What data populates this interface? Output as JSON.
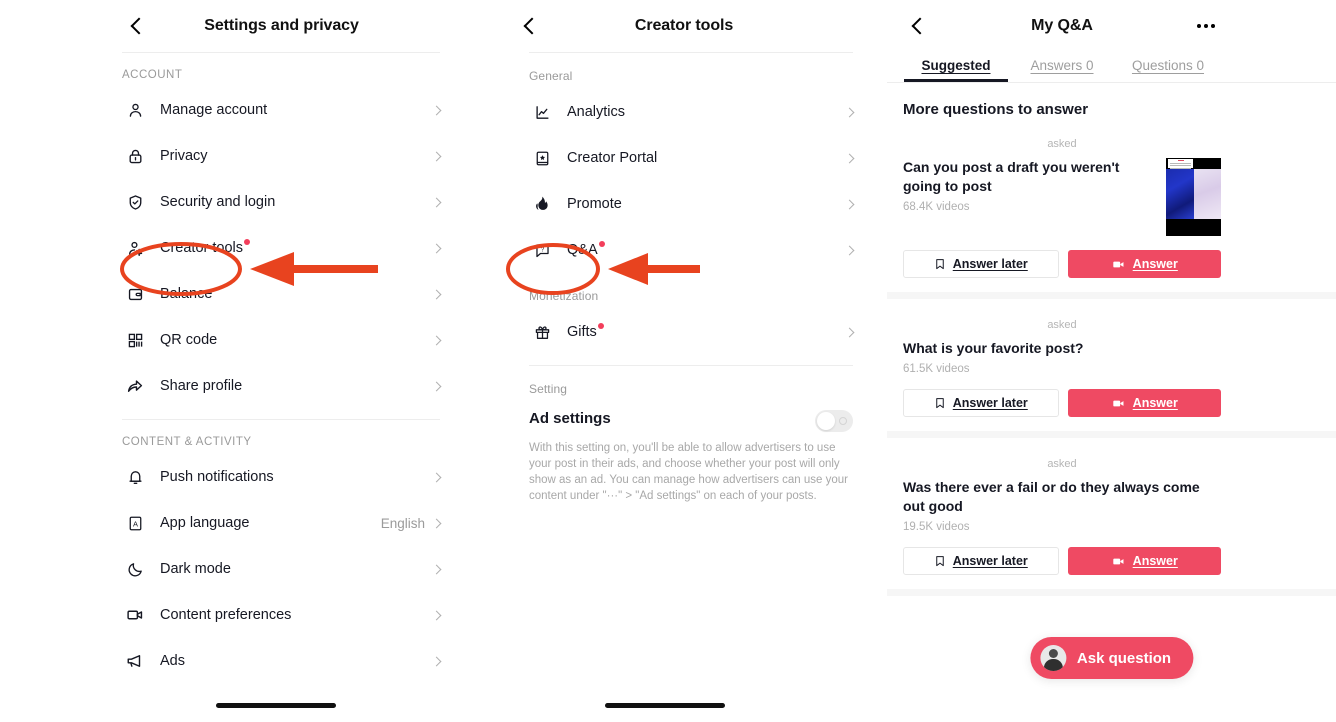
{
  "colors": {
    "accent_red": "#ef4a63",
    "annotation_red": "#e8431f",
    "badge_dot": "#f33e5b",
    "text_primary": "#161823",
    "text_muted": "#9a9a9a"
  },
  "panel_settings": {
    "nav": {
      "title": "Settings and privacy",
      "back_icon": "chevron-left-icon"
    },
    "groups": [
      {
        "label": "ACCOUNT",
        "items": [
          {
            "icon": "person-icon",
            "label": "Manage account",
            "badge": false,
            "value": ""
          },
          {
            "icon": "lock-icon",
            "label": "Privacy",
            "badge": false,
            "value": ""
          },
          {
            "icon": "shield-check-icon",
            "label": "Security and login",
            "badge": false,
            "value": ""
          },
          {
            "icon": "person-gear-icon",
            "label": "Creator tools",
            "badge": true,
            "value": ""
          },
          {
            "icon": "wallet-icon",
            "label": "Balance",
            "badge": false,
            "value": ""
          },
          {
            "icon": "qr-code-icon",
            "label": "QR code",
            "badge": false,
            "value": ""
          },
          {
            "icon": "share-arrow-icon",
            "label": "Share profile",
            "badge": false,
            "value": ""
          }
        ]
      },
      {
        "label": "CONTENT & ACTIVITY",
        "items": [
          {
            "icon": "bell-icon",
            "label": "Push notifications",
            "badge": false,
            "value": ""
          },
          {
            "icon": "letter-a-icon",
            "label": "App language",
            "badge": false,
            "value": "English"
          },
          {
            "icon": "moon-icon",
            "label": "Dark mode",
            "badge": false,
            "value": ""
          },
          {
            "icon": "video-camera-icon",
            "label": "Content preferences",
            "badge": false,
            "value": ""
          },
          {
            "icon": "megaphone-icon",
            "label": "Ads",
            "badge": false,
            "value": ""
          }
        ]
      }
    ]
  },
  "panel_creator": {
    "nav": {
      "title": "Creator tools",
      "back_icon": "chevron-left-icon"
    },
    "groups": [
      {
        "label": "General",
        "items": [
          {
            "icon": "analytics-chart-icon",
            "label": "Analytics",
            "badge": false
          },
          {
            "icon": "book-star-icon",
            "label": "Creator Portal",
            "badge": false
          },
          {
            "icon": "flame-icon",
            "label": "Promote",
            "badge": false
          },
          {
            "icon": "question-bubble-icon",
            "label": "Q&A",
            "badge": true
          }
        ]
      },
      {
        "label": "Monetization",
        "items": [
          {
            "icon": "gift-icon",
            "label": "Gifts",
            "badge": true
          }
        ]
      }
    ],
    "setting_section": {
      "label": "Setting",
      "title": "Ad settings",
      "toggle_on": false,
      "description": "With this setting on, you'll be able to allow advertisers to use your post in their ads, and choose whether your post will only show as an ad. You can manage how advertisers can use your content under \"···\" > \"Ad settings\" on each of your posts."
    }
  },
  "panel_qa": {
    "nav": {
      "title": "My Q&A",
      "back_icon": "chevron-left-icon",
      "more_icon": "more-horizontal-icon"
    },
    "tabs": [
      {
        "label": "Suggested",
        "active": true
      },
      {
        "label": "Answers 0",
        "active": false
      },
      {
        "label": "Questions 0",
        "active": false
      }
    ],
    "section_title": "More questions to answer",
    "questions": [
      {
        "asked_label": "asked",
        "title": "Can you post a draft you weren't going to post",
        "videos": "68.4K videos",
        "has_thumbnail": true,
        "answer_later_label": "Answer later",
        "answer_label": "Answer",
        "bookmark_icon": "bookmark-icon",
        "camera_icon": "video-camera-icon"
      },
      {
        "asked_label": "asked",
        "title": "What is your favorite post?",
        "videos": "61.5K videos",
        "has_thumbnail": false,
        "answer_later_label": "Answer later",
        "answer_label": "Answer",
        "bookmark_icon": "bookmark-icon",
        "camera_icon": "video-camera-icon"
      },
      {
        "asked_label": "asked",
        "title": "Was there ever a fail or do they always come out good",
        "videos": "19.5K videos",
        "has_thumbnail": false,
        "answer_later_label": "Answer later",
        "answer_label": "Answer",
        "bookmark_icon": "bookmark-icon",
        "camera_icon": "video-camera-icon"
      }
    ],
    "ask_button": {
      "label": "Ask question",
      "avatar_icon": "user-avatar-icon"
    }
  },
  "annotations": [
    {
      "name": "creator-tools-highlight",
      "shape": "ellipse-and-arrow"
    },
    {
      "name": "qa-highlight",
      "shape": "ellipse-and-arrow"
    }
  ]
}
